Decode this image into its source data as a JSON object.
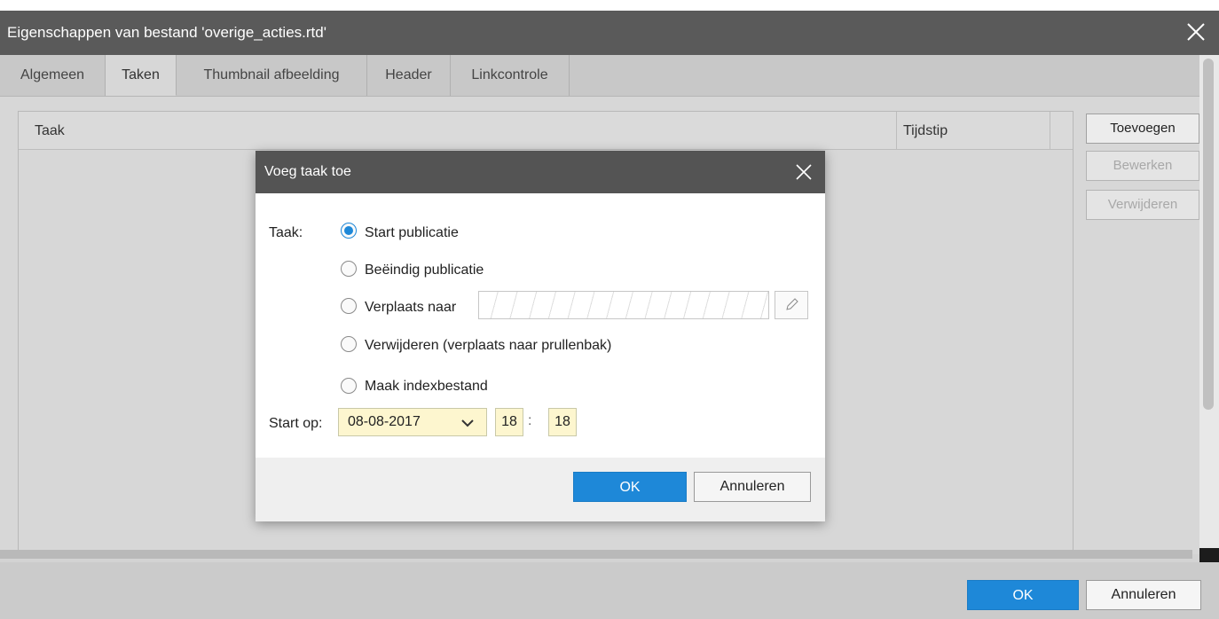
{
  "window": {
    "title": "Eigenschappen van bestand 'overige_acties.rtd'",
    "close_icon": "close-icon"
  },
  "tabs": [
    {
      "label": "Algemeen",
      "active": false
    },
    {
      "label": "Taken",
      "active": true
    },
    {
      "label": "Thumbnail afbeelding",
      "active": false
    },
    {
      "label": "Header",
      "active": false
    },
    {
      "label": "Linkcontrole",
      "active": false
    }
  ],
  "table": {
    "columns": [
      "Taak",
      "Tijdstip"
    ]
  },
  "side_buttons": {
    "add": "Toevoegen",
    "edit": "Bewerken",
    "delete": "Verwijderen"
  },
  "footer": {
    "ok": "OK",
    "cancel": "Annuleren"
  },
  "modal": {
    "title": "Voeg taak toe",
    "task_label": "Taak:",
    "options": [
      {
        "label": "Start publicatie",
        "checked": true
      },
      {
        "label": "Beëindig publicatie",
        "checked": false
      },
      {
        "label": "Verplaats naar",
        "checked": false
      },
      {
        "label": "Verwijderen (verplaats naar prullenbak)",
        "checked": false
      },
      {
        "label": "Maak indexbestand",
        "checked": false
      }
    ],
    "path_value": "",
    "start_label": "Start op:",
    "date_value": "08-08-2017",
    "hour_value": "18",
    "time_separator": ":",
    "minute_value": "18",
    "ok": "OK",
    "cancel": "Annuleren"
  },
  "colors": {
    "accent": "#1e88d8",
    "header_bg": "#5a5a5a",
    "input_bg": "#fdf6cf"
  }
}
